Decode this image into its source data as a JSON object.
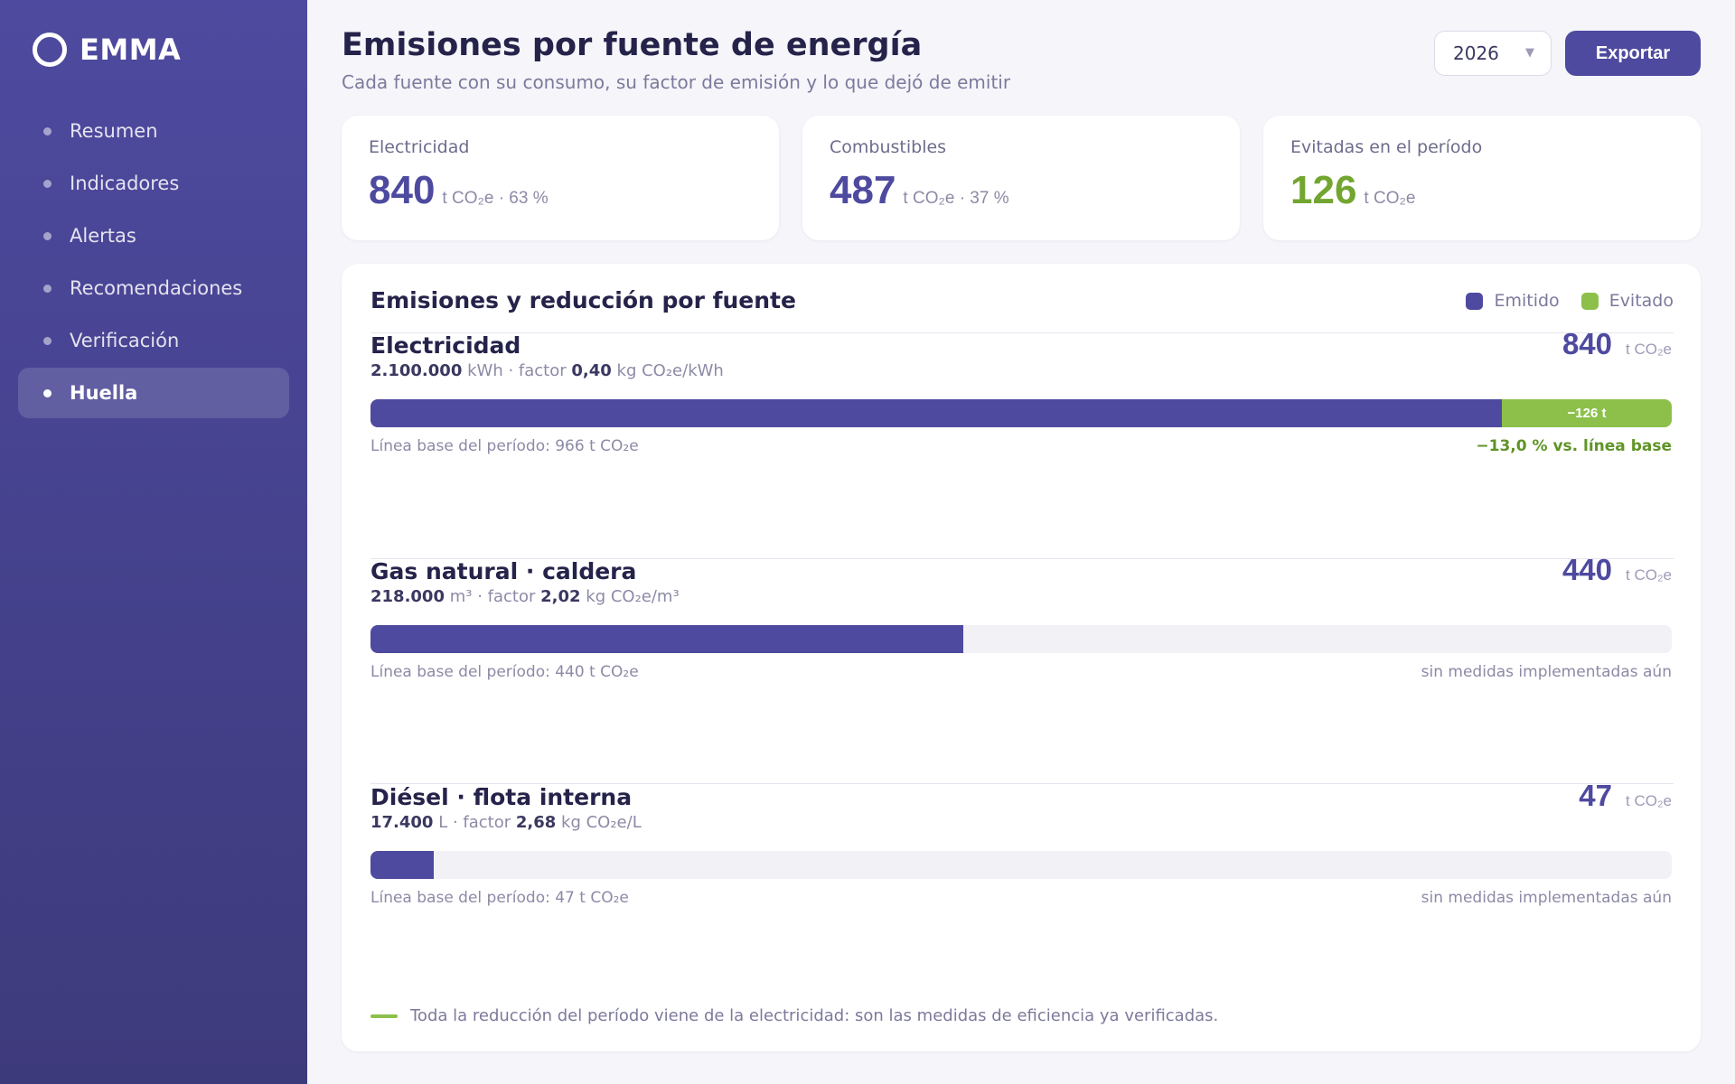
{
  "brand": {
    "name": "EMMA"
  },
  "nav": [
    {
      "label": "Resumen",
      "active": false
    },
    {
      "label": "Indicadores",
      "active": false
    },
    {
      "label": "Alertas",
      "active": false
    },
    {
      "label": "Recomendaciones",
      "active": false
    },
    {
      "label": "Verificación",
      "active": false
    },
    {
      "label": "Huella",
      "active": true
    }
  ],
  "header": {
    "title": "Emisiones por fuente de energía",
    "subtitle": "Cada fuente con su consumo, su factor de emisión y lo que dejó de emitir",
    "year": "2026",
    "export_label": "Exportar"
  },
  "kpis": [
    {
      "label": "Electricidad",
      "value": "840",
      "unit": "t CO₂e · 63 %"
    },
    {
      "label": "Combustibles",
      "value": "487",
      "unit": "t CO₂e · 37 %"
    },
    {
      "label": "Evitadas en el período",
      "value": "126",
      "unit": "t CO₂e"
    }
  ],
  "chart": {
    "title": "Emisiones y reducción por fuente",
    "legend": [
      {
        "label": "Emitido",
        "color": "#4e4a9f"
      },
      {
        "label": "Evitado",
        "color": "#8cc04b"
      }
    ],
    "scale_max": 966,
    "unit": "t CO₂e",
    "sources": [
      {
        "name": "Electricidad",
        "consumption": "2.100.000",
        "consumption_unit": "kWh",
        "factor_label": "factor",
        "factor": "0,40",
        "factor_unit": "kg CO₂e/kWh",
        "emitted": 840,
        "avoided": 126,
        "avoided_label": "−126 t",
        "baseline_text": "Línea base del período: 966 t CO₂e",
        "note": "−13,0 % vs. línea base"
      },
      {
        "name": "Gas natural · caldera",
        "consumption": "218.000",
        "consumption_unit": "m³",
        "factor_label": "factor",
        "factor": "2,02",
        "factor_unit": "kg CO₂e/m³",
        "emitted": 440,
        "avoided": 0,
        "avoided_label": "",
        "baseline_text": "Línea base del período: 440 t CO₂e",
        "note": "sin medidas implementadas aún"
      },
      {
        "name": "Diésel · flota interna",
        "consumption": "17.400",
        "consumption_unit": "L",
        "factor_label": "factor",
        "factor": "2,68",
        "factor_unit": "kg CO₂e/L",
        "emitted": 47,
        "avoided": 0,
        "avoided_label": "",
        "baseline_text": "Línea base del período: 47 t CO₂e",
        "note": "sin medidas implementadas aún"
      }
    ],
    "footnote": "Toda la reducción del período viene de la electricidad: son las medidas de eficiencia ya verificadas."
  }
}
